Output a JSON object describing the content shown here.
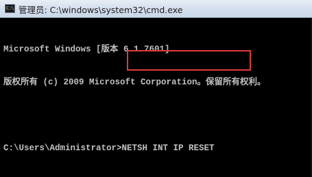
{
  "window": {
    "title": "管理员: C:\\windows\\system32\\cmd.exe",
    "icon": "cmd-icon",
    "icon_glyph": "C:\\"
  },
  "console": {
    "lines": [
      "Microsoft Windows [版本 6.1.7601]",
      "版权所有 (c) 2009 Microsoft Corporation。保留所有权利。",
      "",
      "C:\\Users\\Administrator>NETSH INT IP RESET"
    ],
    "prompt": "C:\\Users\\Administrator>",
    "command": "NETSH INT IP RESET"
  },
  "colors": {
    "console_bg": "#000000",
    "console_text": "#c0c0c0",
    "highlight": "#e23b3b"
  }
}
